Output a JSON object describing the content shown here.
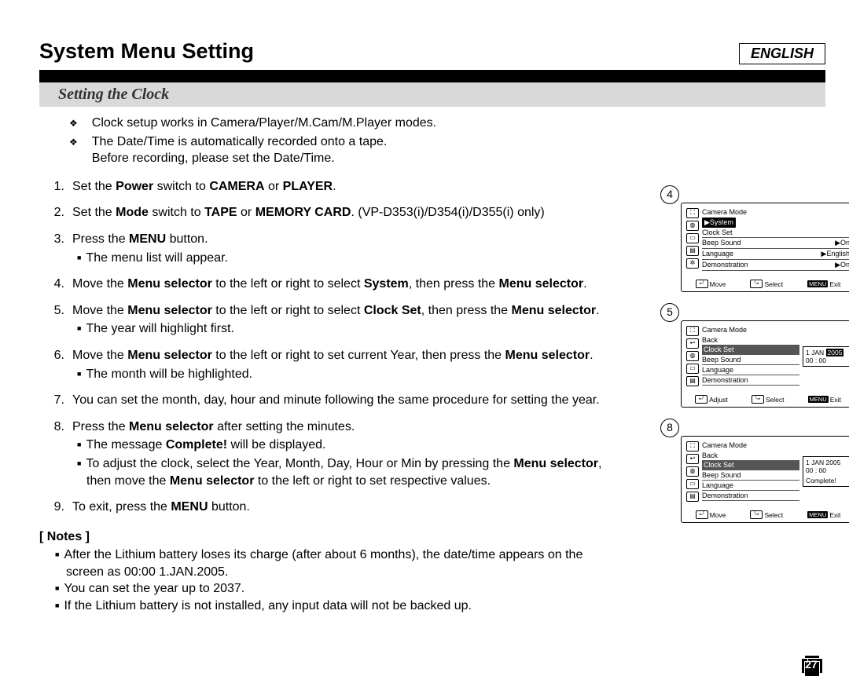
{
  "lang_label": "ENGLISH",
  "title": "System Menu Setting",
  "subtitle": "Setting the Clock",
  "intro": [
    "Clock setup works in Camera/Player/M.Cam/M.Player modes.",
    "The Date/Time is automatically recorded onto a tape.\nBefore recording, please set the Date/Time."
  ],
  "steps": [
    {
      "n": "1.",
      "html": "Set the <b>Power</b> switch to <b>CAMERA</b> or <b>PLAYER</b>."
    },
    {
      "n": "2.",
      "html": "Set the <b>Mode</b> switch to <b>TAPE</b> or <b>MEMORY CARD</b>. (VP-D353(i)/D354(i)/D355(i) only)"
    },
    {
      "n": "3.",
      "html": "Press the <b>MENU</b> button.",
      "subs": [
        "The menu list will appear."
      ]
    },
    {
      "n": "4.",
      "html": "Move the <b>Menu selector</b> to the left or right to select <b>System</b>, then press the <b>Menu selector</b>."
    },
    {
      "n": "5.",
      "html": "Move the <b>Menu selector</b> to the left or right to select <b>Clock Set</b>, then press the <b>Menu selector</b>.",
      "subs": [
        "The year will highlight first."
      ]
    },
    {
      "n": "6.",
      "html": "Move the <b>Menu selector</b> to the left or right to set current Year, then press the <b>Menu selector</b>.",
      "subs": [
        "The month will be highlighted."
      ]
    },
    {
      "n": "7.",
      "html": "You can set the month, day, hour and minute following the same procedure for setting the year."
    },
    {
      "n": "8.",
      "html": "Press the <b>Menu selector</b> after setting the minutes.",
      "subs": [
        "The message <b>Complete!</b> will be displayed.",
        "To adjust the clock, select the Year, Month, Day, Hour or Min by pressing the <b>Menu selector</b>, then move the <b>Menu selector</b> to the left or right to set respective values."
      ]
    },
    {
      "n": "9.",
      "html": "To exit, press the <b>MENU</b> button."
    }
  ],
  "notes_heading": "[ Notes ]",
  "notes": [
    "After the Lithium battery loses its charge (after about 6 months), the date/time appears on the screen as 00:00 1.JAN.2005.",
    "You can set the year up to 2037.",
    "If the Lithium battery is not installed, any input data will not be backed up."
  ],
  "page_number": "27",
  "screens": {
    "common": {
      "title": "Camera Mode",
      "exit": "Exit",
      "select": "Select",
      "menu": "MENU"
    },
    "s4": {
      "circ": "4",
      "header": "▶System",
      "rows": [
        {
          "l": "Clock Set",
          "r": ""
        },
        {
          "l": "Beep Sound",
          "r": "▶On"
        },
        {
          "l": "Language",
          "r": "▶English"
        },
        {
          "l": "Demonstration",
          "r": "▶On"
        }
      ],
      "footL": "Move"
    },
    "s5": {
      "circ": "5",
      "back": "Back",
      "rows": [
        {
          "l": "Clock Set",
          "hl": true
        },
        {
          "l": "Beep Sound"
        },
        {
          "l": "Language"
        },
        {
          "l": "Demonstration"
        }
      ],
      "box": {
        "date_pre": "1 JAN",
        "date_inv": "2005",
        "time": "00 : 00"
      },
      "footL": "Adjust"
    },
    "s8": {
      "circ": "8",
      "back": "Back",
      "rows": [
        {
          "l": "Clock Set",
          "hl": true
        },
        {
          "l": "Beep Sound"
        },
        {
          "l": "Language"
        },
        {
          "l": "Demonstration"
        }
      ],
      "box": {
        "date": "1 JAN   2005",
        "time": "00 : 00",
        "msg": "Complete!"
      },
      "footL": "Move"
    }
  }
}
